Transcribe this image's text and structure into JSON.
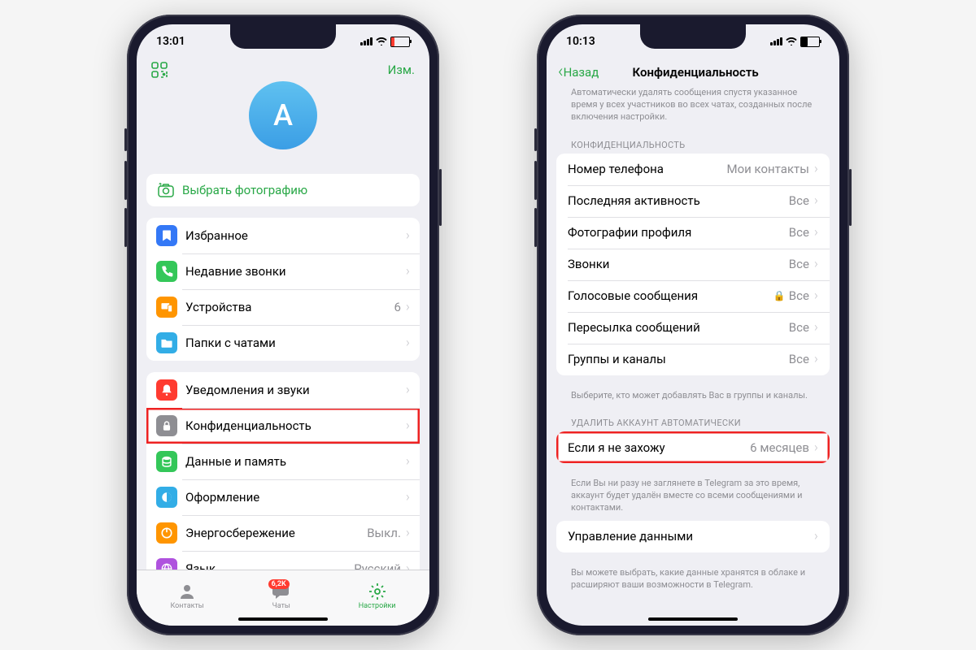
{
  "phone1": {
    "time": "13:01",
    "edit": "Изм.",
    "avatar_letter": "A",
    "choose_photo": "Выбрать фотографию",
    "group1": [
      {
        "icon": "bookmark",
        "label": "Избранное",
        "value": ""
      },
      {
        "icon": "phone",
        "label": "Недавние звонки",
        "value": ""
      },
      {
        "icon": "devices",
        "label": "Устройства",
        "value": "6"
      },
      {
        "icon": "folder",
        "label": "Папки с чатами",
        "value": ""
      }
    ],
    "group2": [
      {
        "icon": "bell",
        "label": "Уведомления и звуки",
        "value": ""
      },
      {
        "icon": "lock",
        "label": "Конфиденциальность",
        "value": "",
        "highlight": true
      },
      {
        "icon": "data",
        "label": "Данные и память",
        "value": ""
      },
      {
        "icon": "theme",
        "label": "Оформление",
        "value": ""
      },
      {
        "icon": "power",
        "label": "Энергосбережение",
        "value": "Выкл."
      },
      {
        "icon": "lang",
        "label": "Язык",
        "value": "Русский"
      }
    ],
    "tabs": {
      "contacts": "Контакты",
      "chats": "Чаты",
      "chats_badge": "6,2K",
      "settings": "Настройки"
    }
  },
  "phone2": {
    "time": "10:13",
    "back": "Назад",
    "title": "Конфиденциальность",
    "top_footer": "Автоматически удалять сообщения спустя указанное время у всех участников во всех чатах, созданных после включения настройки.",
    "sect_privacy": "КОНФИДЕНЦИАЛЬНОСТЬ",
    "privacy_rows": [
      {
        "label": "Номер телефона",
        "value": "Мои контакты"
      },
      {
        "label": "Последняя активность",
        "value": "Все"
      },
      {
        "label": "Фотографии профиля",
        "value": "Все"
      },
      {
        "label": "Звонки",
        "value": "Все"
      },
      {
        "label": "Голосовые сообщения",
        "value": "Все",
        "locked": true
      },
      {
        "label": "Пересылка сообщений",
        "value": "Все"
      },
      {
        "label": "Группы и каналы",
        "value": "Все"
      }
    ],
    "privacy_footer": "Выберите, кто может добавлять Вас в группы и каналы.",
    "sect_delete": "УДАЛИТЬ АККАУНТ АВТОМАТИЧЕСКИ",
    "delete_row": {
      "label": "Если я не захожу",
      "value": "6 месяцев",
      "highlight": true
    },
    "delete_footer": "Если Вы ни разу не заглянете в Telegram за это время, аккаунт будет удалён вместе со всеми сообщениями и контактами.",
    "manage_row": {
      "label": "Управление данными",
      "value": ""
    },
    "manage_footer": "Вы можете выбрать, какие данные хранятся в облаке и расширяют ваши возможности в Telegram."
  },
  "icon_colors": {
    "bookmark": "#3478f6",
    "phone": "#34c759",
    "devices": "#ff9500",
    "folder": "#32ade6",
    "bell": "#ff3b30",
    "lock": "#8e8e93",
    "data": "#34c759",
    "theme": "#32ade6",
    "power": "#ff9500",
    "lang": "#af52de"
  }
}
